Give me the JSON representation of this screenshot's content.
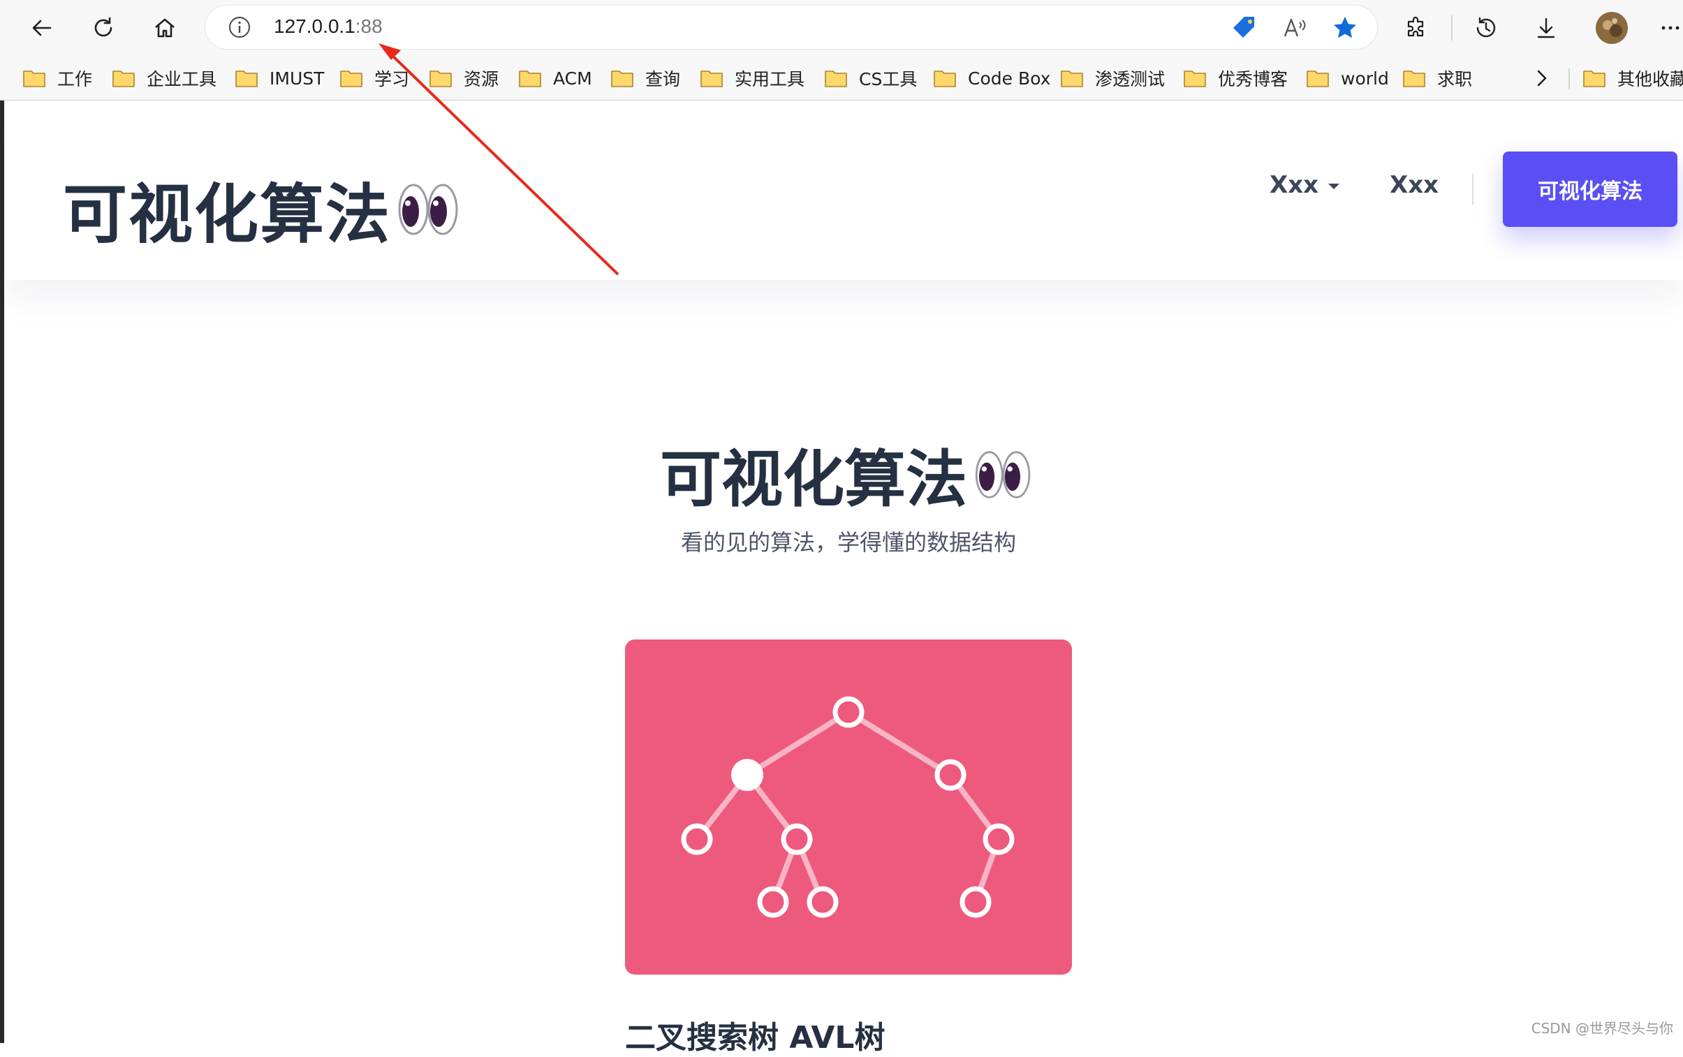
{
  "browser": {
    "url_host": "127.0.0.1",
    "url_port": ":88",
    "bookmarks": [
      {
        "label": "工作"
      },
      {
        "label": "企业工具"
      },
      {
        "label": "IMUST"
      },
      {
        "label": "学习"
      },
      {
        "label": "资源"
      },
      {
        "label": "ACM"
      },
      {
        "label": "查询"
      },
      {
        "label": "实用工具"
      },
      {
        "label": "CS工具"
      },
      {
        "label": "Code Box"
      },
      {
        "label": "渗透测试"
      },
      {
        "label": "优秀博客"
      },
      {
        "label": "world"
      },
      {
        "label": "求职"
      }
    ],
    "other_bookmarks": "其他收藏",
    "more_chevron": "›",
    "icons": [
      "back-icon",
      "refresh-icon",
      "home-icon",
      "info-icon",
      "coupon-tag-icon",
      "read-aloud-icon",
      "favorite-star-icon",
      "extensions-icon",
      "history-icon",
      "download-icon",
      "profile-avatar",
      "more-icon"
    ]
  },
  "site": {
    "logo": "可视化算法",
    "nav": [
      {
        "label": "Xxx",
        "has_dropdown": true
      },
      {
        "label": "Xxx",
        "has_dropdown": false
      }
    ],
    "cta_label": "可视化算法"
  },
  "hero": {
    "title": "可视化算法",
    "subtitle": "看的见的算法，学得懂的数据结构"
  },
  "card": {
    "title": "二叉搜索树 AVL树",
    "image_color": "#ed5a7d"
  },
  "watermark": "CSDN @世界尽头与你",
  "colors": {
    "accent": "#5a4ff5",
    "heading": "#253042",
    "annotation_arrow": "#e8291c"
  }
}
